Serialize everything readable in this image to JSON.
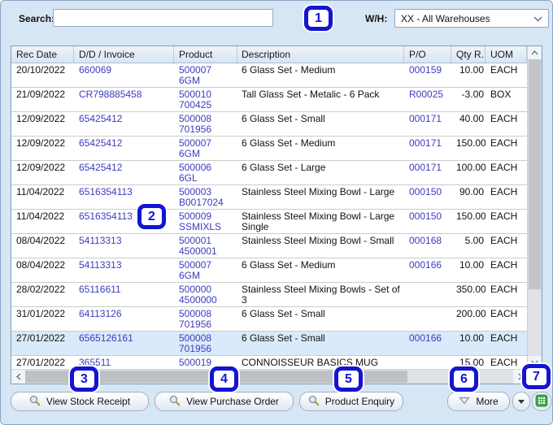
{
  "topbar": {
    "search_label": "Search:",
    "search_value": "",
    "wh_label": "W/H:",
    "warehouse_selected": "XX - All Warehouses"
  },
  "table": {
    "columns": [
      "Rec Date",
      "D/D / Invoice",
      "Product",
      "Description",
      "P/O",
      "Qty R...",
      "UOM"
    ],
    "rows": [
      {
        "rec_date": "20/10/2022",
        "invoice": "660069",
        "product_code": "500007",
        "product_ref": "6GM",
        "description": "6 Glass Set - Medium",
        "po": "000159",
        "qty": "10.00",
        "uom": "EACH",
        "selected": false
      },
      {
        "rec_date": "21/09/2022",
        "invoice": "CR798885458",
        "product_code": "500010",
        "product_ref": "700425",
        "description": "Tall Glass Set - Metalic - 6 Pack",
        "po": "R00025",
        "qty": "-3.00",
        "uom": "BOX",
        "selected": false
      },
      {
        "rec_date": "12/09/2022",
        "invoice": "65425412",
        "product_code": "500008",
        "product_ref": "701956",
        "description": "6 Glass Set - Small",
        "po": "000171",
        "qty": "40.00",
        "uom": "EACH",
        "selected": false
      },
      {
        "rec_date": "12/09/2022",
        "invoice": "65425412",
        "product_code": "500007",
        "product_ref": "6GM",
        "description": "6 Glass Set - Medium",
        "po": "000171",
        "qty": "150.00",
        "uom": "EACH",
        "selected": false
      },
      {
        "rec_date": "12/09/2022",
        "invoice": "65425412",
        "product_code": "500006",
        "product_ref": "6GL",
        "description": "6 Glass Set - Large",
        "po": "000171",
        "qty": "100.00",
        "uom": "EACH",
        "selected": false
      },
      {
        "rec_date": "11/04/2022",
        "invoice": "6516354113",
        "product_code": "500003",
        "product_ref": "B0017024",
        "description": "Stainless Steel Mixing Bowl - Large",
        "po": "000150",
        "qty": "90.00",
        "uom": "EACH",
        "selected": false
      },
      {
        "rec_date": "11/04/2022",
        "invoice": "6516354113",
        "product_code": "500009",
        "product_ref": "SSMIXLS",
        "description": "Stainless Steel Mixing Bowl - Large Single",
        "po": "000150",
        "qty": "150.00",
        "uom": "EACH",
        "selected": false
      },
      {
        "rec_date": "08/04/2022",
        "invoice": "54113313",
        "product_code": "500001",
        "product_ref": "4500001",
        "description": "Stainless Steel Mixing Bowl - Small",
        "po": "000168",
        "qty": "5.00",
        "uom": "EACH",
        "selected": false
      },
      {
        "rec_date": "08/04/2022",
        "invoice": "54113313",
        "product_code": "500007",
        "product_ref": "6GM",
        "description": "6 Glass Set - Medium",
        "po": "000166",
        "qty": "10.00",
        "uom": "EACH",
        "selected": false
      },
      {
        "rec_date": "28/02/2022",
        "invoice": "65116611",
        "product_code": "500000",
        "product_ref": "4500000",
        "description": "Stainless Steel Mixing Bowls - Set of 3",
        "po": "",
        "qty": "350.00",
        "uom": "EACH",
        "selected": false
      },
      {
        "rec_date": "31/01/2022",
        "invoice": "64113126",
        "product_code": "500008",
        "product_ref": "701956",
        "description": "6 Glass Set - Small",
        "po": "",
        "qty": "200.00",
        "uom": "EACH",
        "selected": false
      },
      {
        "rec_date": "27/01/2022",
        "invoice": "6565126161",
        "product_code": "500008",
        "product_ref": "701956",
        "description": "6 Glass Set - Small",
        "po": "000166",
        "qty": "10.00",
        "uom": "EACH",
        "selected": true
      },
      {
        "rec_date": "27/01/2022",
        "invoice": "365511",
        "product_code": "500019",
        "product_ref": "",
        "description": "CONNOISSEUR BASICS MUG",
        "po": "",
        "qty": "15.00",
        "uom": "EACH",
        "selected": false
      }
    ]
  },
  "buttons": {
    "view_stock_receipt": "View Stock Receipt",
    "view_purchase_order": "View Purchase Order",
    "product_enquiry": "Product Enquiry",
    "more": "More"
  },
  "icons": {
    "search_buttons": "magnifier-icon",
    "more_button": "triangle-down-icon",
    "split_button": "caret-down-icon",
    "export_button": "excel-export-icon",
    "warehouse_dropdown": "chevron-down-icon"
  },
  "callouts": [
    "1",
    "2",
    "3",
    "4",
    "5",
    "6",
    "7"
  ],
  "colors": {
    "window_bg": "#d7e6f5",
    "link_text": "#3c3cbe",
    "selected_row": "#d9eafa",
    "callout_blue": "#1414d2",
    "excel_green": "#3fa94c"
  }
}
